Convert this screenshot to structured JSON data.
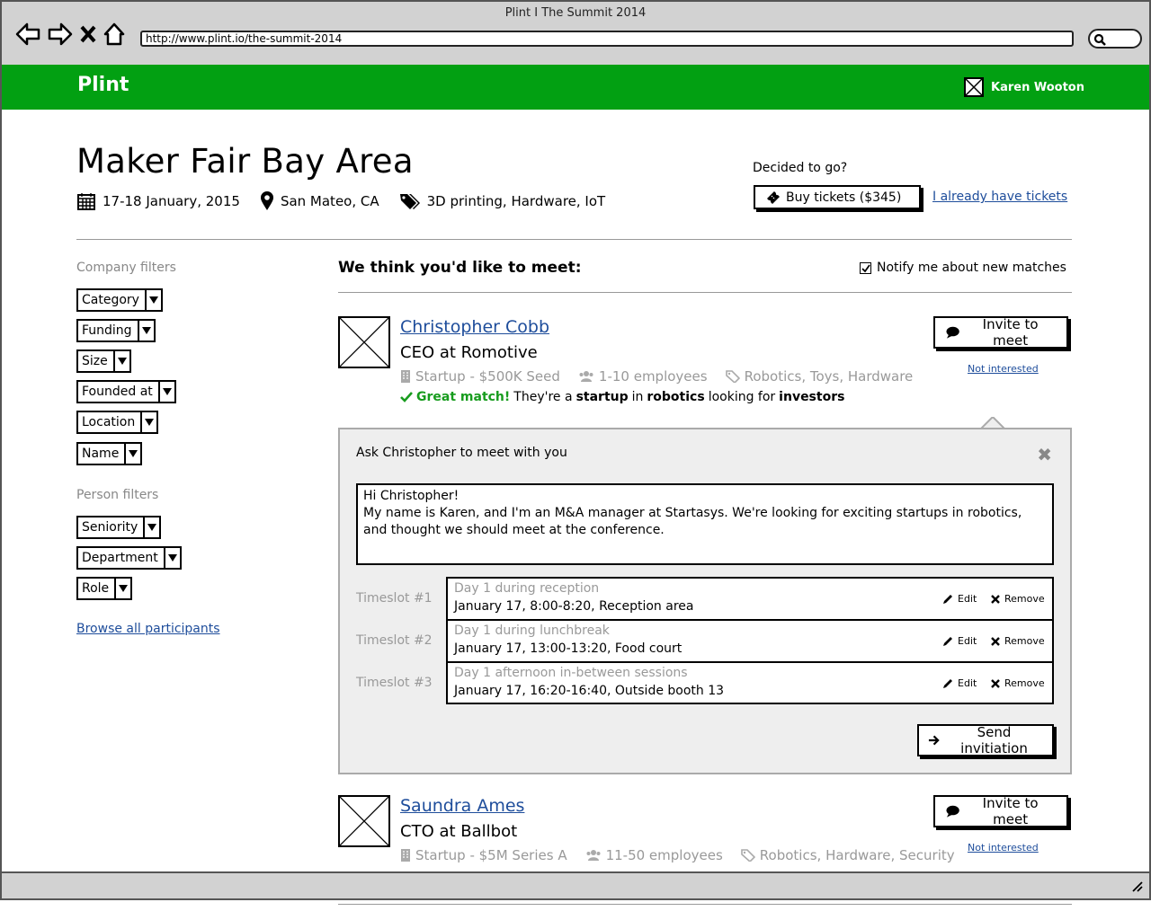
{
  "browser": {
    "title": "Plint I The Summit 2014",
    "url": "http://www.plint.io/the-summit-2014"
  },
  "topbar": {
    "brand": "Plint",
    "user_name": "Karen Wooton"
  },
  "event": {
    "title": "Maker Fair Bay Area",
    "date": "17-18 January, 2015",
    "location": "San Mateo, CA",
    "tags": "3D printing, Hardware, IoT",
    "decided_label": "Decided to go?",
    "buy_label": "Buy tickets ($345)",
    "have_tickets_label": "I already have tickets"
  },
  "sidebar": {
    "company_heading": "Company filters",
    "company_filters": [
      "Category",
      "Funding",
      "Size",
      "Founded at",
      "Location",
      "Name"
    ],
    "person_heading": "Person filters",
    "person_filters": [
      "Seniority",
      "Department",
      "Role"
    ],
    "browse_label": "Browse all participants"
  },
  "main": {
    "title": "We think you'd like to meet:",
    "notify_label": "Notify me about new matches",
    "notify_checked": true
  },
  "people": [
    {
      "name": "Christopher Cobb",
      "role": "CEO at Romotive",
      "company": "Startup - $500K Seed",
      "employees": "1-10 employees",
      "tags": "Robotics, Toys, Hardware",
      "invite_label": "Invite to meet",
      "not_interested_label": "Not interested",
      "match": {
        "great": "Great match!",
        "p1": "They're a",
        "b1": "startup",
        "p2": "in",
        "b2": "robotics",
        "p3": "looking for",
        "b3": "investors"
      }
    },
    {
      "name": "Saundra Ames",
      "role": "CTO at Ballbot",
      "company": "Startup - $5M Series A",
      "employees": "11-50 employees",
      "tags": "Robotics, Hardware, Security",
      "invite_label": "Invite to meet",
      "not_interested_label": "Not interested"
    }
  ],
  "invite_panel": {
    "title": "Ask Christopher to meet with you",
    "close": "✖",
    "message": "Hi Christopher!\nMy name is Karen, and I'm an M&A manager at Startasys. We're looking for exciting startups in robotics, and thought we should meet at the conference.",
    "timeslots": [
      {
        "label": "Timeslot #1",
        "sub": "Day 1 during reception",
        "main": "January 17, 8:00-8:20, Reception area"
      },
      {
        "label": "Timeslot #2",
        "sub": "Day 1 during lunchbreak",
        "main": "January 17, 13:00-13:20, Food court"
      },
      {
        "label": "Timeslot #3",
        "sub": "Day 1 afternoon in-between sessions",
        "main": "January 17, 16:20-16:40, Outside booth 13"
      }
    ],
    "edit_label": "Edit",
    "remove_label": "Remove",
    "send_label": "Send invitiation"
  }
}
